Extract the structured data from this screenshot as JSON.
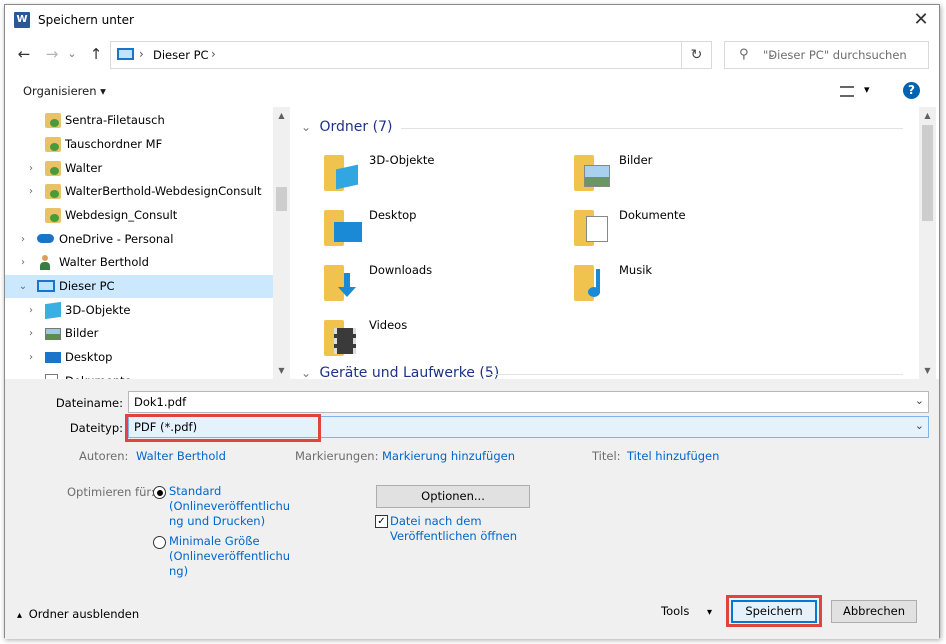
{
  "window": {
    "title": "Speichern unter",
    "app_icon": "W"
  },
  "nav": {
    "back_icon": "←",
    "forward_icon": "→",
    "recent_icon": "⌄",
    "up_icon": "↑",
    "breadcrumb": "Dieser PC",
    "breadcrumb_sep": "›",
    "dropdown_icon": "⌄",
    "refresh_icon": "↻",
    "search_placeholder": "\"Dieser PC\" durchsuchen",
    "search_icon": "⚲"
  },
  "toolbar": {
    "organize_label": "Organisieren",
    "organize_caret": "▾",
    "view_caret": "▾",
    "help_label": "?"
  },
  "sidebar": {
    "items": [
      {
        "label": "Sentra-Filetausch",
        "icon": "shared-folder-icon",
        "chevron": ""
      },
      {
        "label": "Tauschordner MF",
        "icon": "shared-folder-icon",
        "chevron": ""
      },
      {
        "label": "Walter",
        "icon": "shared-folder-icon",
        "chevron": "›"
      },
      {
        "label": "WalterBerthold-WebdesignConsult",
        "icon": "shared-folder-icon",
        "chevron": "›"
      },
      {
        "label": "Webdesign_Consult",
        "icon": "shared-folder-icon",
        "chevron": ""
      },
      {
        "label": "OneDrive - Personal",
        "icon": "onedrive-icon",
        "chevron": "›"
      },
      {
        "label": "Walter Berthold",
        "icon": "user-icon",
        "chevron": "›"
      },
      {
        "label": "Dieser PC",
        "icon": "computer-icon",
        "chevron": "⌄"
      },
      {
        "label": "3D-Objekte",
        "icon": "3d-objects-icon",
        "chevron": "›"
      },
      {
        "label": "Bilder",
        "icon": "pictures-icon",
        "chevron": "›"
      },
      {
        "label": "Desktop",
        "icon": "desktop-icon",
        "chevron": "›"
      },
      {
        "label": "Dokumente",
        "icon": "documents-icon",
        "chevron": "›"
      }
    ]
  },
  "content": {
    "group1": "Ordner (7)",
    "group2": "Geräte und Laufwerke (5)",
    "group_chevron": "⌄",
    "folders": [
      "3D-Objekte",
      "Bilder",
      "Desktop",
      "Dokumente",
      "Downloads",
      "Musik",
      "Videos"
    ]
  },
  "form": {
    "filename_label": "Dateiname:",
    "filename_value": "Dok1.pdf",
    "filetype_label": "Dateityp:",
    "filetype_value": "PDF (*.pdf)",
    "authors_label": "Autoren:",
    "authors_value": "Walter Berthold",
    "tags_label": "Markierungen:",
    "tags_value": "Markierung hinzufügen",
    "title_label": "Titel:",
    "title_value": "Titel hinzufügen",
    "optimize_label": "Optimieren für:",
    "opt_standard": [
      "Standard",
      "(Onlineveröffentlichu",
      "ng und Drucken)"
    ],
    "opt_min": [
      "Minimale Größe",
      "(Onlineveröffentlichu",
      "ng)"
    ],
    "options_button": "Optionen...",
    "open_after": [
      "Datei nach dem",
      "Veröffentlichen öffnen"
    ],
    "check_mark": "✓"
  },
  "footer": {
    "hide_folders": "Ordner ausblenden",
    "hide_caret": "▴",
    "tools": "Tools",
    "tools_caret": "▾",
    "save": "Speichern",
    "cancel": "Abbrechen"
  },
  "colors": {
    "selection": "#cce8ff",
    "accent": "#0078d7",
    "link": "#0066cc",
    "highlight_box": "#e0443f",
    "group_header": "#1e3287"
  }
}
